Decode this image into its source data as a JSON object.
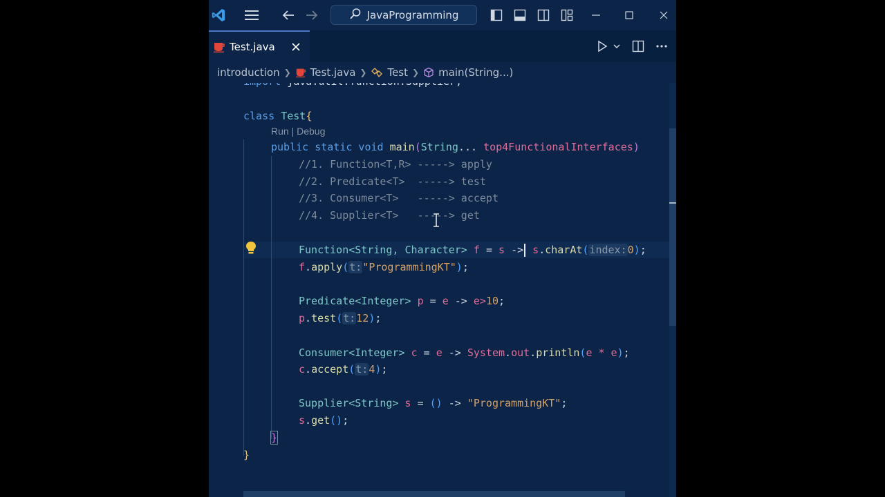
{
  "titlebar": {
    "search_text": "JavaProgramming"
  },
  "tab": {
    "label": "Test.java"
  },
  "breadcrumb": {
    "folder": "introduction",
    "file": "Test.java",
    "class": "Test",
    "method": "main(String...)"
  },
  "codelens": "Run | Debug",
  "code": {
    "l0_kw": "import",
    "l0_rest": " java.util.function.Supplier;",
    "l1_kw": "class",
    "l1_name": "Test",
    "l2_a": "public static void",
    "l2_fn": "main",
    "l2_type": "String",
    "l2_dots": "...",
    "l2_param": "top4FunctionalInterfaces",
    "c1": "//1. Function<T,R> -----> apply",
    "c2": "//2. Predicate<T>  -----> test",
    "c3": "//3. Consumer<T>   -----> accept",
    "c4": "//4. Supplier<T>   -----> get",
    "f1_type": "Function<String, Character>",
    "f1_var": "f",
    "f1_param": "s",
    "f1_arrow": "->",
    "f1_recv": "s",
    "f1_call": "charAt",
    "f1_hint": "index:",
    "f1_num": "0",
    "f2_recv": "f",
    "f2_call": "apply",
    "f2_hint": "t:",
    "f2_str": "\"ProgrammingKT\"",
    "p1_type": "Predicate<Integer>",
    "p1_var": "p",
    "p1_param": "e",
    "p1_body": "e>",
    "p1_num": "10",
    "p2_recv": "p",
    "p2_call": "test",
    "p2_hint": "t:",
    "p2_num": "12",
    "s1_type": "Consumer<Integer>",
    "s1_var": "c",
    "s1_param": "e",
    "s1_sys": "System",
    "s1_out": "out",
    "s1_call": "println",
    "s1_args": "e * e",
    "s2_recv": "c",
    "s2_call": "accept",
    "s2_hint": "t:",
    "s2_num": "4",
    "u1_type": "Supplier<String>",
    "u1_var": "s",
    "u1_str": "\"ProgrammingKT\"",
    "u2_recv": "s",
    "u2_call": "get"
  },
  "icons": [
    "vscode-logo-icon",
    "menu-icon",
    "arrow-left-icon",
    "arrow-right-icon",
    "search-icon",
    "toggle-primary-sidebar-icon",
    "toggle-panel-icon",
    "toggle-secondary-sidebar-icon",
    "customize-layout-icon",
    "minimize-icon",
    "maximize-icon",
    "close-icon",
    "java-file-icon",
    "run-icon",
    "split-editor-icon",
    "more-actions-icon",
    "lightbulb-icon",
    "class-icon",
    "method-icon"
  ],
  "colors": {
    "background": "#0b2447",
    "accent": "#4a78c2",
    "java_icon": "#e2463b"
  }
}
